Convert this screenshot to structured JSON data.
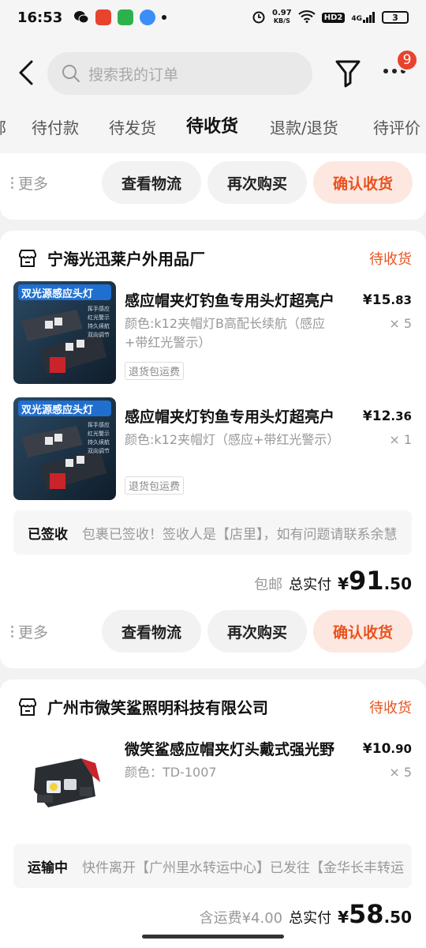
{
  "status_bar": {
    "time": "16:53",
    "net_speed_value": "0.97",
    "net_speed_unit": "KB/S",
    "hd": "HD2",
    "signal": "4G",
    "battery": "3"
  },
  "header": {
    "search_placeholder": "搜索我的订单",
    "badge_count": "9"
  },
  "tabs": [
    {
      "label": "部"
    },
    {
      "label": "待付款"
    },
    {
      "label": "待发货"
    },
    {
      "label": "待收货",
      "active": true
    },
    {
      "label": "退款/退货"
    },
    {
      "label": "待评价"
    }
  ],
  "actions": {
    "more": "更多",
    "logistics": "查看物流",
    "buy_again": "再次购买",
    "confirm": "确认收货"
  },
  "orders": [
    {
      "shop": "宁海光迅莱户外用品厂",
      "status": "待收货",
      "items": [
        {
          "title": "感应帽夹灯钓鱼专用头灯超亮户",
          "spec": "颜色:k12夹帽灯B高配长续航（感应+带红光警示）",
          "tag": "退货包运费",
          "price_int": "¥15",
          "price_dec": ".83",
          "qty": "× 5",
          "img_banner": "双光源感应头灯",
          "img_features": [
            "挥手感应",
            "红光警示",
            "持久续航",
            "双向调节"
          ]
        },
        {
          "title": "感应帽夹灯钓鱼专用头灯超亮户",
          "spec": "颜色:k12夹帽灯（感应+带红光警示）",
          "tag": "退货包运费",
          "price_int": "¥12",
          "price_dec": ".36",
          "qty": "× 1",
          "img_banner": "双光源感应头灯",
          "img_features": [
            "挥手感应",
            "红光警示",
            "持久续航",
            "双向调节"
          ]
        }
      ],
      "logistics_status": "已签收",
      "logistics_text": "包裹已签收！签收人是【店里】，如有问题请联系余慧",
      "shipping": "包邮",
      "total_label": "总实付",
      "total_cur": "¥",
      "total_int": "91",
      "total_dec": ".50"
    },
    {
      "shop": "广州市微笑鲨照明科技有限公司",
      "status": "待收货",
      "items": [
        {
          "title": "微笑鲨感应帽夹灯头戴式强光野",
          "spec": "颜色：TD-1007",
          "price_int": "¥10",
          "price_dec": ".90",
          "qty": "× 5"
        }
      ],
      "logistics_status": "运输中",
      "logistics_text": "快件离开【广州里水转运中心】已发往【金华长丰转运",
      "shipping": "含运费¥4.00",
      "total_label": "总实付",
      "total_cur": "¥",
      "total_int": "58",
      "total_dec": ".50"
    }
  ],
  "colors": {
    "accent": "#e8531f",
    "accent_bg": "#fde8e1",
    "badge": "#e8432e",
    "page_bg": "#f2f2f2"
  }
}
